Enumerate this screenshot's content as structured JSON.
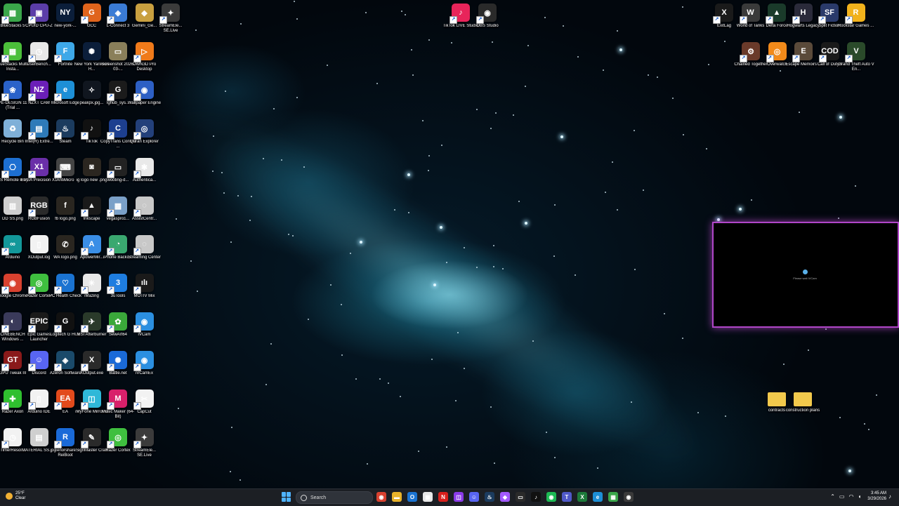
{
  "desktop": {
    "icons": [
      {
        "label": "BlueStacks 5",
        "sym": "▦",
        "color": "#3aa64a",
        "col": 0,
        "row": 0,
        "shortcut": true
      },
      {
        "label": "CPUID CPU-Z",
        "sym": "▣",
        "color": "#5b3da8",
        "col": 1,
        "row": 0,
        "shortcut": true
      },
      {
        "label": "new-york-...",
        "sym": "NY",
        "color": "#0b1e3a",
        "col": 2,
        "row": 0,
        "shortcut": false
      },
      {
        "label": "GCC",
        "sym": "G",
        "color": "#e0641c",
        "col": 3,
        "row": 0,
        "shortcut": true
      },
      {
        "label": "L-Connect 3",
        "sym": "◈",
        "color": "#3a7bd5",
        "col": 4,
        "row": 0,
        "shortcut": true
      },
      {
        "label": "Gemini_Ge...",
        "sym": "◆",
        "color": "#c9a040",
        "col": 5,
        "row": 0,
        "shortcut": false
      },
      {
        "label": "StreamEle... SE.Live",
        "sym": "✦",
        "color": "#3b3b3b",
        "col": 6,
        "row": 0,
        "shortcut": true
      },
      {
        "label": "BlueStacks Multi-Insta...",
        "sym": "▦",
        "color": "#4bbf3a",
        "col": 0,
        "row": 1,
        "shortcut": true
      },
      {
        "label": "UserBench...",
        "sym": "◷",
        "color": "#e8e8e8",
        "col": 1,
        "row": 1,
        "shortcut": true
      },
      {
        "label": "Fortnite",
        "sym": "F",
        "color": "#3ea8e8",
        "col": 2,
        "row": 1,
        "shortcut": true
      },
      {
        "label": "New York Yankees H...",
        "sym": "✺",
        "color": "#0b1e3a",
        "col": 3,
        "row": 1,
        "shortcut": false
      },
      {
        "label": "Screenshot 2026-03-...",
        "sym": "▭",
        "color": "#8a7f5a",
        "col": 4,
        "row": 1,
        "shortcut": false
      },
      {
        "label": "OWN3D Pro Desktop",
        "sym": "▷",
        "color": "#f07a1a",
        "col": 5,
        "row": 1,
        "shortcut": true
      },
      {
        "label": "PE-DESIGN 11 (Trial ...",
        "sym": "❀",
        "color": "#2a62c9",
        "col": 0,
        "row": 2,
        "shortcut": true
      },
      {
        "label": "NZXT CAM",
        "sym": "NZ",
        "color": "#6b1fb8",
        "col": 1,
        "row": 2,
        "shortcut": true
      },
      {
        "label": "Microsoft Edge",
        "sym": "e",
        "color": "#1d8fd6",
        "col": 2,
        "row": 2,
        "shortcut": true
      },
      {
        "label": "peakpx.jpg...",
        "sym": "✧",
        "color": "#10161f",
        "col": 3,
        "row": 2,
        "shortcut": false
      },
      {
        "label": "lghub_sys...",
        "sym": "G",
        "color": "#1b1b1b",
        "col": 4,
        "row": 2,
        "shortcut": true
      },
      {
        "label": "Wallpaper Engine",
        "sym": "◉",
        "color": "#2d5fc4",
        "col": 5,
        "row": 2,
        "shortcut": true
      },
      {
        "label": "Recycle Bin",
        "sym": "♻",
        "color": "#7fb0d8",
        "col": 0,
        "row": 3,
        "shortcut": false
      },
      {
        "label": "Intel(R) Extre...",
        "sym": "▤",
        "color": "#2e7ab8",
        "col": 1,
        "row": 3,
        "shortcut": true
      },
      {
        "label": "Steam",
        "sym": "♨",
        "color": "#1b3b5e",
        "col": 2,
        "row": 3,
        "shortcut": true
      },
      {
        "label": "TikTok",
        "sym": "♪",
        "color": "#111111",
        "col": 3,
        "row": 3,
        "shortcut": true
      },
      {
        "label": "CopyTrans Control ...",
        "sym": "C",
        "color": "#1d3f8f",
        "col": 4,
        "row": 3,
        "shortcut": true
      },
      {
        "label": "Quran Explorer",
        "sym": "◎",
        "color": "#23407a",
        "col": 5,
        "row": 3,
        "shortcut": true
      },
      {
        "label": "PS Remote Play",
        "sym": "⎔",
        "color": "#1d6fd1",
        "col": 0,
        "row": 4,
        "shortcut": true
      },
      {
        "label": "EVGA Precision X1",
        "sym": "X1",
        "color": "#6a2fa8",
        "col": 1,
        "row": 4,
        "shortcut": true
      },
      {
        "label": "AntiMicro",
        "sym": "⌨",
        "color": "#444444",
        "col": 2,
        "row": 4,
        "shortcut": true
      },
      {
        "label": "ig logo new .png",
        "sym": "◙",
        "color": "#2b2620",
        "col": 3,
        "row": 4,
        "shortcut": false
      },
      {
        "label": "wooting-d...",
        "sym": "▭",
        "color": "#222222",
        "col": 4,
        "row": 4,
        "shortcut": true
      },
      {
        "label": "Authentica...",
        "sym": "✱",
        "color": "#e9e9e9",
        "col": 5,
        "row": 4,
        "shortcut": true
      },
      {
        "label": "DD SS.png",
        "sym": "▥",
        "color": "#cfcfcf",
        "col": 0,
        "row": 5,
        "shortcut": false
      },
      {
        "label": "RGBFusion",
        "sym": "RGB",
        "color": "#2a2a2a",
        "col": 1,
        "row": 5,
        "shortcut": true
      },
      {
        "label": "fb logo.png",
        "sym": "f",
        "color": "#2a2620",
        "col": 2,
        "row": 5,
        "shortcut": false
      },
      {
        "label": "Inkscape",
        "sym": "▲",
        "color": "#1a1a1a",
        "col": 3,
        "row": 5,
        "shortcut": true
      },
      {
        "label": "vegaspro1...",
        "sym": "▦",
        "color": "#7aa0c8",
        "col": 4,
        "row": 5,
        "shortcut": true
      },
      {
        "label": "AssistCentr...",
        "sym": "◌",
        "color": "#c8c8c8",
        "col": 5,
        "row": 5,
        "shortcut": true
      },
      {
        "label": "Arduino",
        "sym": "∞",
        "color": "#13989a",
        "col": 0,
        "row": 6,
        "shortcut": true
      },
      {
        "label": "XOutput.log",
        "sym": "▯",
        "color": "#f2f2f2",
        "col": 1,
        "row": 6,
        "shortcut": false
      },
      {
        "label": "WA logo.png",
        "sym": "✆",
        "color": "#2a2620",
        "col": 2,
        "row": 6,
        "shortcut": false
      },
      {
        "label": "ApowerMir...",
        "sym": "A",
        "color": "#3a8ee6",
        "col": 3,
        "row": 6,
        "shortcut": true
      },
      {
        "label": "iPhone Backu...",
        "sym": "◔",
        "color": "#3aa870",
        "col": 4,
        "row": 6,
        "shortcut": true
      },
      {
        "label": "Streaming Center",
        "sym": "◌",
        "color": "#c8c8c8",
        "col": 5,
        "row": 6,
        "shortcut": true
      },
      {
        "label": "Google Chrome",
        "sym": "◉",
        "color": "#d8412f",
        "col": 0,
        "row": 7,
        "shortcut": true
      },
      {
        "label": "Razer Cortex",
        "sym": "◎",
        "color": "#3fbf3f",
        "col": 1,
        "row": 7,
        "shortcut": true
      },
      {
        "label": "PC Health Check",
        "sym": "♡",
        "color": "#1a73d1",
        "col": 2,
        "row": 7,
        "shortcut": true
      },
      {
        "label": "iMazing",
        "sym": "✳",
        "color": "#e8e8e8",
        "col": 3,
        "row": 7,
        "shortcut": true
      },
      {
        "label": "3uTools",
        "sym": "3",
        "color": "#1e7de0",
        "col": 4,
        "row": 7,
        "shortcut": true
      },
      {
        "label": "MOTIV Mix",
        "sym": "ılı",
        "color": "#1a1a1a",
        "col": 5,
        "row": 7,
        "shortcut": true
      },
      {
        "label": "CINEBENCH Windows ...",
        "sym": "◐",
        "color": "#3a3a5a",
        "col": 0,
        "row": 8,
        "shortcut": true
      },
      {
        "label": "Epic Games Launcher",
        "sym": "EPIC",
        "color": "#1a1a1a",
        "col": 1,
        "row": 8,
        "shortcut": true
      },
      {
        "label": "Logitech G HUB",
        "sym": "G",
        "color": "#111111",
        "col": 2,
        "row": 8,
        "shortcut": true
      },
      {
        "label": "MSI Afterburner",
        "sym": "✈",
        "color": "#2a3a2a",
        "col": 3,
        "row": 8,
        "shortcut": true
      },
      {
        "label": "SewArt64",
        "sym": "✿",
        "color": "#3aa83a",
        "col": 4,
        "row": 8,
        "shortcut": true
      },
      {
        "label": "iVCam",
        "sym": "◉",
        "color": "#2b8fe0",
        "col": 5,
        "row": 8,
        "shortcut": true
      },
      {
        "label": "GPU Tweak III",
        "sym": "GT",
        "color": "#8a1a1a",
        "col": 0,
        "row": 9,
        "shortcut": true
      },
      {
        "label": "Discord",
        "sym": "☺",
        "color": "#5865f2",
        "col": 1,
        "row": 9,
        "shortcut": true
      },
      {
        "label": "Azeron Software",
        "sym": "◈",
        "color": "#1a4a6a",
        "col": 2,
        "row": 9,
        "shortcut": true
      },
      {
        "label": "XOutput.exe",
        "sym": "X",
        "color": "#2a2a2a",
        "col": 3,
        "row": 9,
        "shortcut": true
      },
      {
        "label": "Battle.net",
        "sym": "✺",
        "color": "#1a6ad8",
        "col": 4,
        "row": 9,
        "shortcut": true
      },
      {
        "label": "iVCamEx",
        "sym": "◉",
        "color": "#2b8fe0",
        "col": 5,
        "row": 9,
        "shortcut": true
      },
      {
        "label": "Razer Axon",
        "sym": "✚",
        "color": "#2fbf2f",
        "col": 0,
        "row": 10,
        "shortcut": true
      },
      {
        "label": "Arduino IDE",
        "sym": "▯",
        "color": "#f2f2f2",
        "col": 1,
        "row": 10,
        "shortcut": true
      },
      {
        "label": "EA",
        "sym": "EA",
        "color": "#e24a1c",
        "col": 2,
        "row": 10,
        "shortcut": true
      },
      {
        "label": "iMyFone MirrorTo",
        "sym": "◫",
        "color": "#2fb8d8",
        "col": 3,
        "row": 10,
        "shortcut": true
      },
      {
        "label": "Music Maker (64-Bit)",
        "sym": "M",
        "color": "#d8206a",
        "col": 4,
        "row": 10,
        "shortcut": true
      },
      {
        "label": "CapCut",
        "sym": "✂",
        "color": "#f2f2f2",
        "col": 5,
        "row": 10,
        "shortcut": true
      },
      {
        "label": "TimerResol...",
        "sym": "◷",
        "color": "#f2f2f2",
        "col": 0,
        "row": 11,
        "shortcut": true
      },
      {
        "label": "MATERIAL SS.jpg",
        "sym": "▤",
        "color": "#cfcfcf",
        "col": 1,
        "row": 11,
        "shortcut": false
      },
      {
        "label": "Tenorshare ReiBoot",
        "sym": "R",
        "color": "#1a6ad8",
        "col": 2,
        "row": 11,
        "shortcut": true
      },
      {
        "label": "SignMaster Craft",
        "sym": "✎",
        "color": "#2a2a2a",
        "col": 3,
        "row": 11,
        "shortcut": true
      },
      {
        "label": "Razer Cortex",
        "sym": "◎",
        "color": "#3fbf3f",
        "col": 4,
        "row": 11,
        "shortcut": true
      },
      {
        "label": "StreamEle... SE.Live",
        "sym": "✦",
        "color": "#3b3b3b",
        "col": 5,
        "row": 11,
        "shortcut": true
      }
    ],
    "top_center_icons": [
      {
        "label": "TikTok LIVE Studio",
        "sym": "♪",
        "color": "#e8245a",
        "shortcut": true
      },
      {
        "label": "OBS Studio",
        "sym": "◉",
        "color": "#2a2a2a",
        "shortcut": true
      }
    ],
    "top_right_icons": [
      {
        "label": "ExitLag",
        "sym": "X",
        "color": "#1a1a1a",
        "row": 0,
        "shortcut": true
      },
      {
        "label": "World of Tanks",
        "sym": "W",
        "color": "#3a3a3a",
        "row": 0,
        "shortcut": true
      },
      {
        "label": "Delta Force",
        "sym": "▲",
        "color": "#1a3a2a",
        "row": 0,
        "shortcut": true
      },
      {
        "label": "Hogwarts Legacy",
        "sym": "H",
        "color": "#2a2a3a",
        "row": 0,
        "shortcut": true
      },
      {
        "label": "Split Fiction",
        "sym": "SF",
        "color": "#2a3a6a",
        "row": 0,
        "shortcut": true
      },
      {
        "label": "Rockstar Games ...",
        "sym": "R",
        "color": "#f2b21c",
        "row": 0,
        "shortcut": true
      },
      {
        "label": "Chained Together",
        "sym": "⚙",
        "color": "#6a3a2a",
        "row": 1,
        "shortcut": true
      },
      {
        "label": "Overwatch",
        "sym": "◎",
        "color": "#f28a1a",
        "row": 1,
        "shortcut": true
      },
      {
        "label": "Escape Memoirs ...",
        "sym": "E",
        "color": "#5a4a3a",
        "row": 1,
        "shortcut": true
      },
      {
        "label": "Call of Duty®",
        "sym": "COD",
        "color": "#1a1a1a",
        "row": 1,
        "shortcut": true
      },
      {
        "label": "Grand Theft Auto V En...",
        "sym": "V",
        "color": "#2a4a2a",
        "row": 1,
        "shortcut": true
      }
    ],
    "folders": [
      {
        "label": "contracts"
      },
      {
        "label": "construction plans"
      }
    ]
  },
  "preview_window": {
    "text": "Please wait iVCam"
  },
  "taskbar": {
    "weather_temp": "25°F",
    "weather_desc": "Clear",
    "search_placeholder": "Search",
    "time": "3:45 AM",
    "date": "3/29/2026",
    "apps": [
      {
        "name": "chrome",
        "sym": "◉",
        "color": "#d8412f"
      },
      {
        "name": "file-explorer",
        "sym": "▬",
        "color": "#e8b22a"
      },
      {
        "name": "outlook",
        "sym": "O",
        "color": "#1a73d1"
      },
      {
        "name": "calendar",
        "sym": "▦",
        "color": "#e8e8e8"
      },
      {
        "name": "netflix",
        "sym": "N",
        "color": "#d8201c"
      },
      {
        "name": "twitch",
        "sym": "◫",
        "color": "#8a3ae8"
      },
      {
        "name": "discord",
        "sym": "☺",
        "color": "#5865f2"
      },
      {
        "name": "steam",
        "sym": "♨",
        "color": "#1b3b5e"
      },
      {
        "name": "figma",
        "sym": "◆",
        "color": "#a259ff"
      },
      {
        "name": "terminal",
        "sym": "▭",
        "color": "#2a2a2a"
      },
      {
        "name": "tiktok",
        "sym": "♪",
        "color": "#111111"
      },
      {
        "name": "spotify",
        "sym": "◉",
        "color": "#1db954"
      },
      {
        "name": "teams",
        "sym": "T",
        "color": "#5059c9"
      },
      {
        "name": "excel",
        "sym": "X",
        "color": "#1d7a3a"
      },
      {
        "name": "edge",
        "sym": "e",
        "color": "#1d8fd6"
      },
      {
        "name": "bluestacks",
        "sym": "▦",
        "color": "#3aa64a"
      },
      {
        "name": "obs",
        "sym": "◉",
        "color": "#3a3a3a"
      }
    ]
  }
}
